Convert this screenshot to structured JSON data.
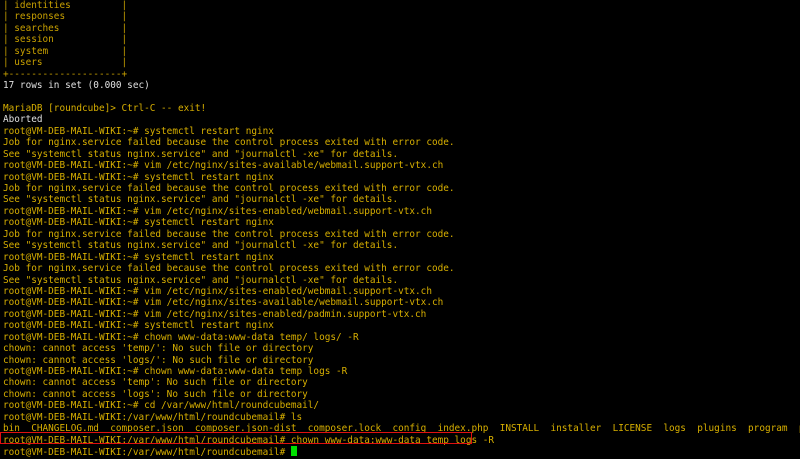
{
  "terminal": {
    "lines": [
      {
        "text": "| identities         |",
        "style": "table"
      },
      {
        "text": "| responses          |",
        "style": "table"
      },
      {
        "text": "| searches           |",
        "style": "table"
      },
      {
        "text": "| session            |",
        "style": "table"
      },
      {
        "text": "| system             |",
        "style": "table"
      },
      {
        "text": "| users              |",
        "style": "table"
      },
      {
        "text": "+--------------------+",
        "style": "table"
      },
      {
        "text": "17 rows in set (0.000 sec)",
        "style": "white"
      },
      {
        "text": "",
        "style": "white"
      },
      {
        "text": "MariaDB [roundcube]> Ctrl-C -- exit!",
        "style": "yellow"
      },
      {
        "text": "Aborted",
        "style": "white"
      },
      {
        "text": "root@VM-DEB-MAIL-WIKI:~# systemctl restart nginx",
        "style": "yellow"
      },
      {
        "text": "Job for nginx.service failed because the control process exited with error code.",
        "style": "yellow"
      },
      {
        "text": "See \"systemctl status nginx.service\" and \"journalctl -xe\" for details.",
        "style": "yellow"
      },
      {
        "text": "root@VM-DEB-MAIL-WIKI:~# vim /etc/nginx/sites-available/webmail.support-vtx.ch",
        "style": "yellow"
      },
      {
        "text": "root@VM-DEB-MAIL-WIKI:~# systemctl restart nginx",
        "style": "yellow"
      },
      {
        "text": "Job for nginx.service failed because the control process exited with error code.",
        "style": "yellow"
      },
      {
        "text": "See \"systemctl status nginx.service\" and \"journalctl -xe\" for details.",
        "style": "yellow"
      },
      {
        "text": "root@VM-DEB-MAIL-WIKI:~# vim /etc/nginx/sites-enabled/webmail.support-vtx.ch",
        "style": "yellow"
      },
      {
        "text": "root@VM-DEB-MAIL-WIKI:~# systemctl restart nginx",
        "style": "yellow"
      },
      {
        "text": "Job for nginx.service failed because the control process exited with error code.",
        "style": "yellow"
      },
      {
        "text": "See \"systemctl status nginx.service\" and \"journalctl -xe\" for details.",
        "style": "yellow"
      },
      {
        "text": "root@VM-DEB-MAIL-WIKI:~# systemctl restart nginx",
        "style": "yellow"
      },
      {
        "text": "Job for nginx.service failed because the control process exited with error code.",
        "style": "yellow"
      },
      {
        "text": "See \"systemctl status nginx.service\" and \"journalctl -xe\" for details.",
        "style": "yellow"
      },
      {
        "text": "root@VM-DEB-MAIL-WIKI:~# vim /etc/nginx/sites-enabled/webmail.support-vtx.ch",
        "style": "yellow"
      },
      {
        "text": "root@VM-DEB-MAIL-WIKI:~# vim /etc/nginx/sites-available/webmail.support-vtx.ch",
        "style": "yellow"
      },
      {
        "text": "root@VM-DEB-MAIL-WIKI:~# vim /etc/nginx/sites-enabled/padmin.support-vtx.ch",
        "style": "yellow"
      },
      {
        "text": "root@VM-DEB-MAIL-WIKI:~# systemctl restart nginx",
        "style": "yellow"
      },
      {
        "text": "root@VM-DEB-MAIL-WIKI:~# chown www-data:www-data temp/ logs/ -R",
        "style": "yellow"
      },
      {
        "text": "chown: cannot access 'temp/': No such file or directory",
        "style": "yellow"
      },
      {
        "text": "chown: cannot access 'logs/': No such file or directory",
        "style": "yellow"
      },
      {
        "text": "root@VM-DEB-MAIL-WIKI:~# chown www-data:www-data temp logs -R",
        "style": "yellow"
      },
      {
        "text": "chown: cannot access 'temp': No such file or directory",
        "style": "yellow"
      },
      {
        "text": "chown: cannot access 'logs': No such file or directory",
        "style": "yellow"
      },
      {
        "text": "root@VM-DEB-MAIL-WIKI:~# cd /var/www/html/roundcubemail/",
        "style": "yellow"
      },
      {
        "text": "root@VM-DEB-MAIL-WIKI:/var/www/html/roundcubemail# ls",
        "style": "yellow"
      },
      {
        "text": "bin  CHANGELOG.md  composer.json  composer.json-dist  composer.lock  config  index.php  INSTALL  installer  LICENSE  logs  plugins  program  public_html",
        "style": "yellow"
      },
      {
        "text": "root@VM-DEB-MAIL-WIKI:/var/www/html/roundcubemail# chown www-data:www-data temp logs -R",
        "style": "yellow"
      },
      {
        "text": "root@VM-DEB-MAIL-WIKI:/var/www/html/roundcubemail# ",
        "style": "yellow",
        "cursor": true
      }
    ]
  },
  "colors": {
    "background": "#000000",
    "text_yellow": "#d7af00",
    "text_white": "#e0e0e0",
    "highlight_border": "#e01010",
    "cursor": "#00e000"
  }
}
